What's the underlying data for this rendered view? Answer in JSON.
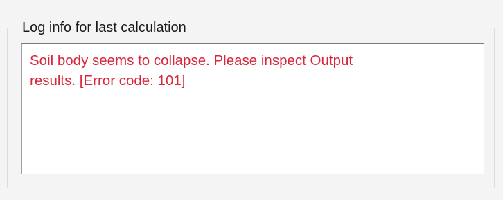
{
  "group": {
    "title": "Log info for last calculation"
  },
  "log": {
    "message": "Soil body seems to collapse. Please inspect Output\nresults. [Error code: 101]"
  },
  "colors": {
    "error_text": "#d8263b",
    "title_text": "#1a1a1a"
  }
}
